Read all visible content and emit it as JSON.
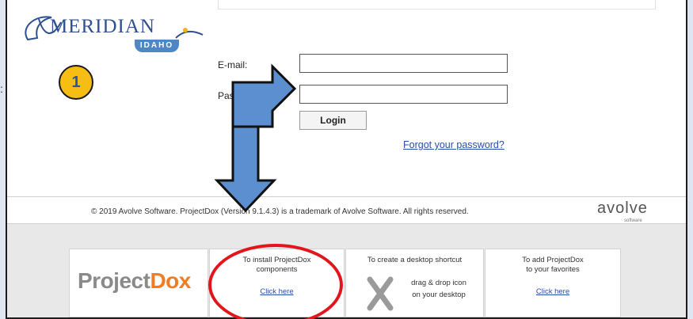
{
  "outside": {
    "colon_fragment": ":"
  },
  "header": {
    "logo_text": "MERIDIAN",
    "logo_sub": "IDAHO"
  },
  "badge": {
    "number": "1"
  },
  "form": {
    "email_label": "E-mail:",
    "password_label": "Password:",
    "email_value": "",
    "password_value": "",
    "login_label": "Login",
    "forgot_link": "Forgot your password?"
  },
  "footer": {
    "copyright": "© 2019 Avolve Software. ProjectDox (Version 9.1.4.3) is a trademark of Avolve Software. All rights reserved.",
    "brand_text": "avolve",
    "brand_sub": "software"
  },
  "cards": {
    "logo": {
      "project": "Project",
      "dox": "Dox"
    },
    "install": {
      "line1": "To install ProjectDox",
      "line2": "components",
      "link": "Click here"
    },
    "shortcut": {
      "line1": "To create a desktop shortcut",
      "line2": "drag & drop icon",
      "line3": "on your desktop"
    },
    "favorites": {
      "line1": "To add ProjectDox",
      "line2": "to your favorites",
      "link": "Click here"
    }
  },
  "colors": {
    "arrow_fill": "#5b8fd0",
    "circle": "#e3151c",
    "badge": "#f6bd13",
    "link": "#2a4fa8",
    "dox_orange": "#f47c20"
  }
}
